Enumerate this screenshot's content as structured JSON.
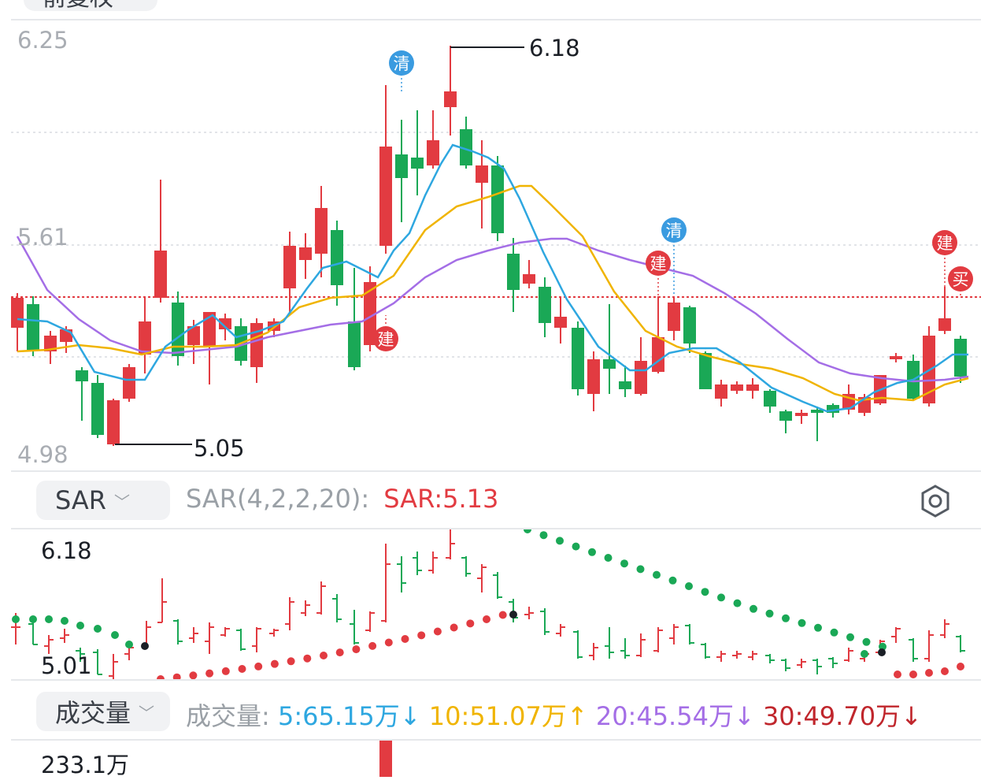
{
  "top_tab_label": "前复权",
  "main_chart": {
    "y_max_label": "6.25",
    "y_mid_label": "5.61",
    "y_min_label": "4.98",
    "high_label": "6.18",
    "low_label": "5.05",
    "markers": [
      {
        "text": "清",
        "color": "#3a9be0"
      },
      {
        "text": "建",
        "color": "#e23b41"
      },
      {
        "text": "清",
        "color": "#3a9be0"
      },
      {
        "text": "建",
        "color": "#e23b41"
      },
      {
        "text": "建",
        "color": "#e23b41"
      },
      {
        "text": "买",
        "color": "#e23b41"
      }
    ]
  },
  "sar_panel": {
    "selector_label": "SAR",
    "params_label": "SAR(4,2,2,20):",
    "value_label": "SAR:5.13",
    "y_max_label": "6.18",
    "y_min_label": "5.01"
  },
  "volume_panel": {
    "selector_label": "成交量",
    "title_label": "成交量:",
    "ma5": "5:65.15万",
    "ma5_arrow": "↓",
    "ma10": "10:51.07万",
    "ma10_arrow": "↑",
    "ma20": "20:45.54万",
    "ma20_arrow": "↓",
    "ma30": "30:49.70万",
    "ma30_arrow": "↓",
    "y_max_label": "233.1万"
  },
  "colors": {
    "up": "#e23b41",
    "down": "#1aa856",
    "ma5": "#2ea7e0",
    "ma10": "#f0b400",
    "ma20": "#a46ee6",
    "ma30": "#c0262c"
  }
}
